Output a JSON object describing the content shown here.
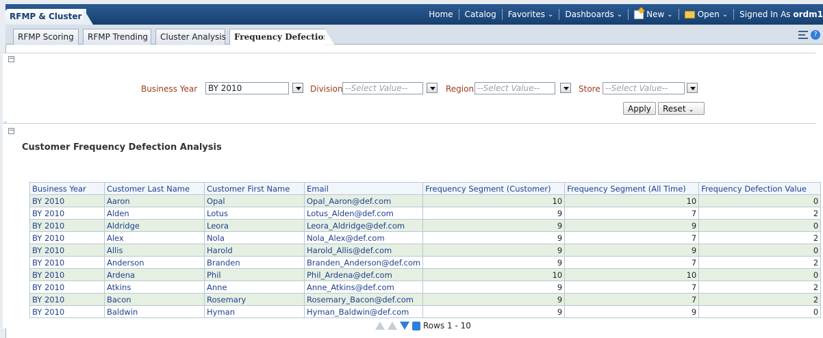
{
  "app": {
    "title": "RFMP & Cluster"
  },
  "nav": {
    "home": "Home",
    "catalog": "Catalog",
    "favorites": "Favorites",
    "dashboards": "Dashboards",
    "new": "New",
    "open": "Open",
    "signed_in_label": "Signed In As",
    "user": "ordm1"
  },
  "tabs": [
    {
      "label": "RFMP Scoring"
    },
    {
      "label": "RFMP Trending"
    },
    {
      "label": "Cluster Analysis"
    },
    {
      "label": "Frequency Defection",
      "active": true
    }
  ],
  "prompts": {
    "business_year_label": "Business Year",
    "business_year_value": "BY 2010",
    "division_label": "Division",
    "division_placeholder": "--Select Value--",
    "region_label": "Region",
    "region_placeholder": "--Select Value--",
    "store_label": "Store",
    "store_placeholder": "--Select Value--",
    "apply": "Apply",
    "reset": "Reset"
  },
  "report": {
    "title": "Customer Frequency Defection Analysis",
    "columns": [
      "Business Year",
      "Customer Last Name",
      "Customer First Name",
      "Email",
      "Frequency Segment (Customer)",
      "Frequency Segment (All Time)",
      "Frequency Defection Value"
    ],
    "rows": [
      [
        "BY 2010",
        "Aaron",
        "Opal",
        "Opal_Aaron@def.com",
        "10",
        "10",
        "0"
      ],
      [
        "BY 2010",
        "Alden",
        "Lotus",
        "Lotus_Alden@def.com",
        "9",
        "7",
        "2"
      ],
      [
        "BY 2010",
        "Aldridge",
        "Leora",
        "Leora_Aldridge@def.com",
        "9",
        "9",
        "0"
      ],
      [
        "BY 2010",
        "Alex",
        "Nola",
        "Nola_Alex@def.com",
        "9",
        "7",
        "2"
      ],
      [
        "BY 2010",
        "Allis",
        "Harold",
        "Harold_Allis@def.com",
        "9",
        "9",
        "0"
      ],
      [
        "BY 2010",
        "Anderson",
        "Branden",
        "Branden_Anderson@def.com",
        "9",
        "7",
        "2"
      ],
      [
        "BY 2010",
        "Ardena",
        "Phil",
        "Phil_Ardena@def.com",
        "10",
        "10",
        "0"
      ],
      [
        "BY 2010",
        "Atkins",
        "Anne",
        "Anne_Atkins@def.com",
        "9",
        "7",
        "2"
      ],
      [
        "BY 2010",
        "Bacon",
        "Rosemary",
        "Rosemary_Bacon@def.com",
        "9",
        "7",
        "2"
      ],
      [
        "BY 2010",
        "Baldwin",
        "Hyman",
        "Hyman_Baldwin@def.com",
        "9",
        "9",
        "0"
      ]
    ],
    "pager_text": "Rows 1 - 10"
  }
}
